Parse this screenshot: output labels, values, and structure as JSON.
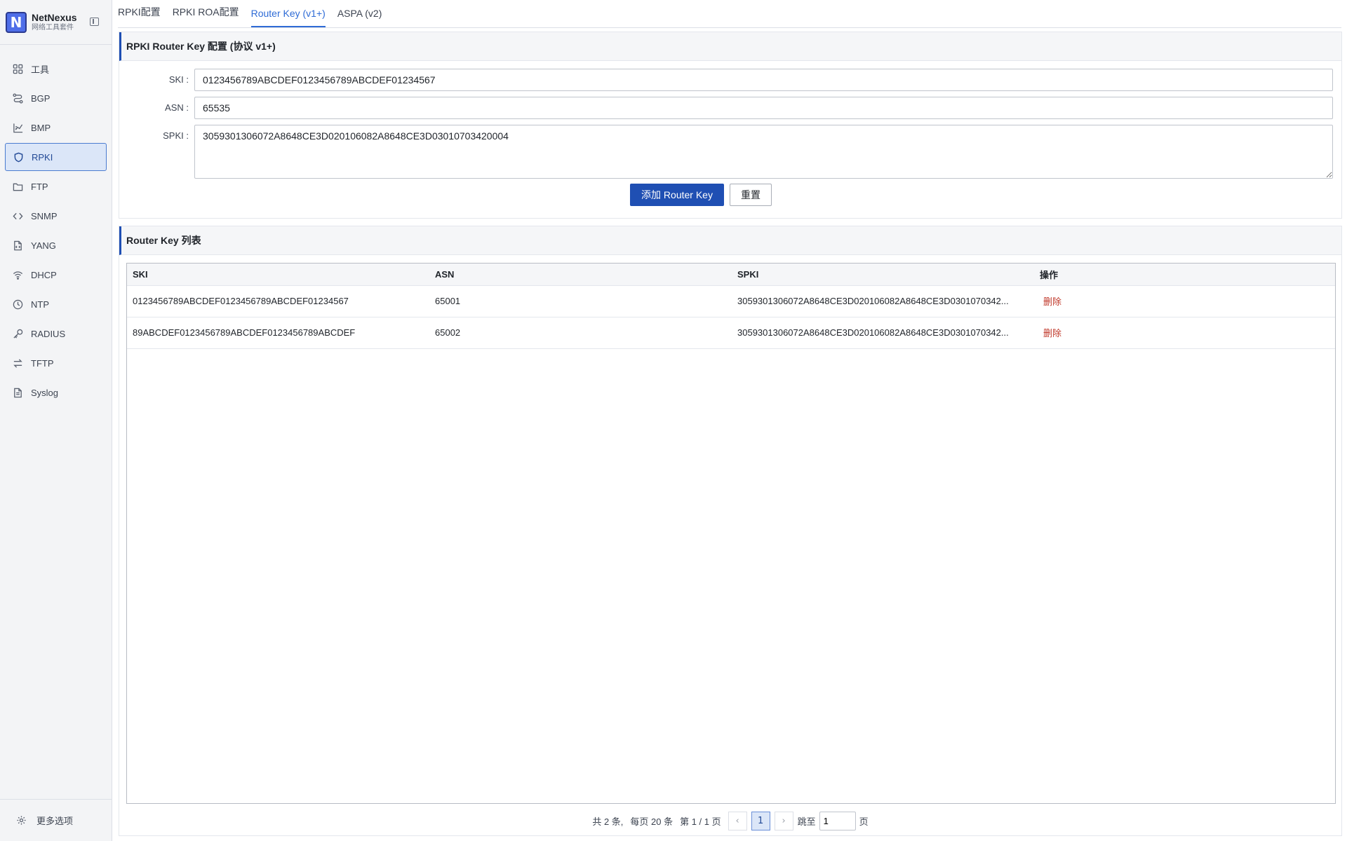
{
  "brand": {
    "name": "NetNexus",
    "subtitle": "网络工具套件",
    "logo_letter": "N"
  },
  "sidebar": {
    "items": [
      {
        "label": "工具",
        "icon": "grid-icon",
        "active": false
      },
      {
        "label": "BGP",
        "icon": "route-icon",
        "active": false
      },
      {
        "label": "BMP",
        "icon": "chart-icon",
        "active": false
      },
      {
        "label": "RPKI",
        "icon": "shield-icon",
        "active": true
      },
      {
        "label": "FTP",
        "icon": "folder-icon",
        "active": false
      },
      {
        "label": "SNMP",
        "icon": "code-icon",
        "active": false
      },
      {
        "label": "YANG",
        "icon": "file-code-icon",
        "active": false
      },
      {
        "label": "DHCP",
        "icon": "wifi-icon",
        "active": false
      },
      {
        "label": "NTP",
        "icon": "clock-icon",
        "active": false
      },
      {
        "label": "RADIUS",
        "icon": "key-icon",
        "active": false
      },
      {
        "label": "TFTP",
        "icon": "transfer-icon",
        "active": false
      },
      {
        "label": "Syslog",
        "icon": "document-icon",
        "active": false
      }
    ],
    "footer_label": "更多选项"
  },
  "tabs": [
    {
      "label": "RPKI配置",
      "active": false
    },
    {
      "label": "RPKI ROA配置",
      "active": false
    },
    {
      "label": "Router Key (v1+)",
      "active": true
    },
    {
      "label": "ASPA (v2)",
      "active": false
    }
  ],
  "config_card": {
    "title": "RPKI Router Key 配置 (协议 v1+)",
    "ski_label": "SKI :",
    "ski_value": "0123456789ABCDEF0123456789ABCDEF01234567",
    "asn_label": "ASN :",
    "asn_value": "65535",
    "spki_label": "SPKI :",
    "spki_value": "3059301306072A8648CE3D020106082A8648CE3D03010703420004",
    "add_button": "添加 Router Key",
    "reset_button": "重置"
  },
  "list_card": {
    "title": "Router Key 列表",
    "columns": {
      "ski": "SKI",
      "asn": "ASN",
      "spki": "SPKI",
      "action": "操作"
    },
    "rows": [
      {
        "ski": "0123456789ABCDEF0123456789ABCDEF01234567",
        "asn": "65001",
        "spki": "3059301306072A8648CE3D020106082A8648CE3D0301070342...",
        "action": "删除"
      },
      {
        "ski": "89ABCDEF0123456789ABCDEF0123456789ABCDEF",
        "asn": "65002",
        "spki": "3059301306072A8648CE3D020106082A8648CE3D0301070342...",
        "action": "删除"
      }
    ]
  },
  "pagination": {
    "total_text": "共 2 条,",
    "per_page_text": "每页 20 条",
    "page_info": "第 1 / 1 页",
    "prev": "‹",
    "current_page": "1",
    "next": "›",
    "jump_label": "跳至",
    "jump_value": "1",
    "page_suffix": "页"
  },
  "colors": {
    "accent": "#1f4fb3",
    "active_tab": "#2e6bd6",
    "danger": "#c0392b",
    "sidebar_bg": "#f3f4f6"
  }
}
